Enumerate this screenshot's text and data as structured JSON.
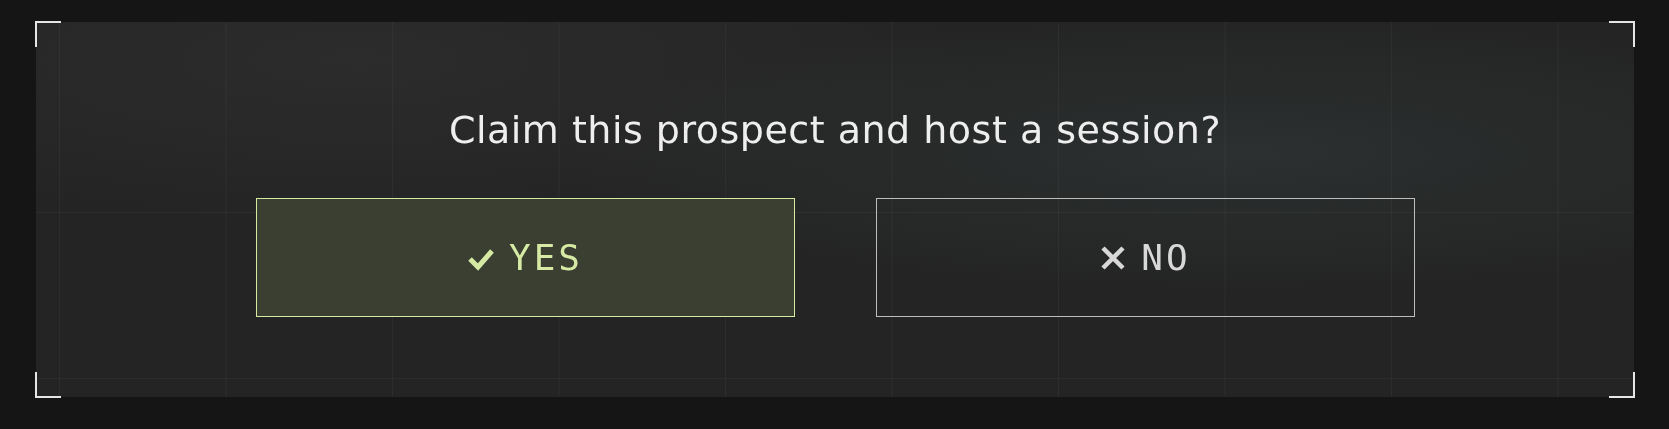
{
  "prompt": "Claim this prospect and host a session?",
  "buttons": [
    {
      "label": "YES",
      "kind": "confirm",
      "selected": true
    },
    {
      "label": "NO",
      "kind": "cancel",
      "selected": false
    }
  ]
}
